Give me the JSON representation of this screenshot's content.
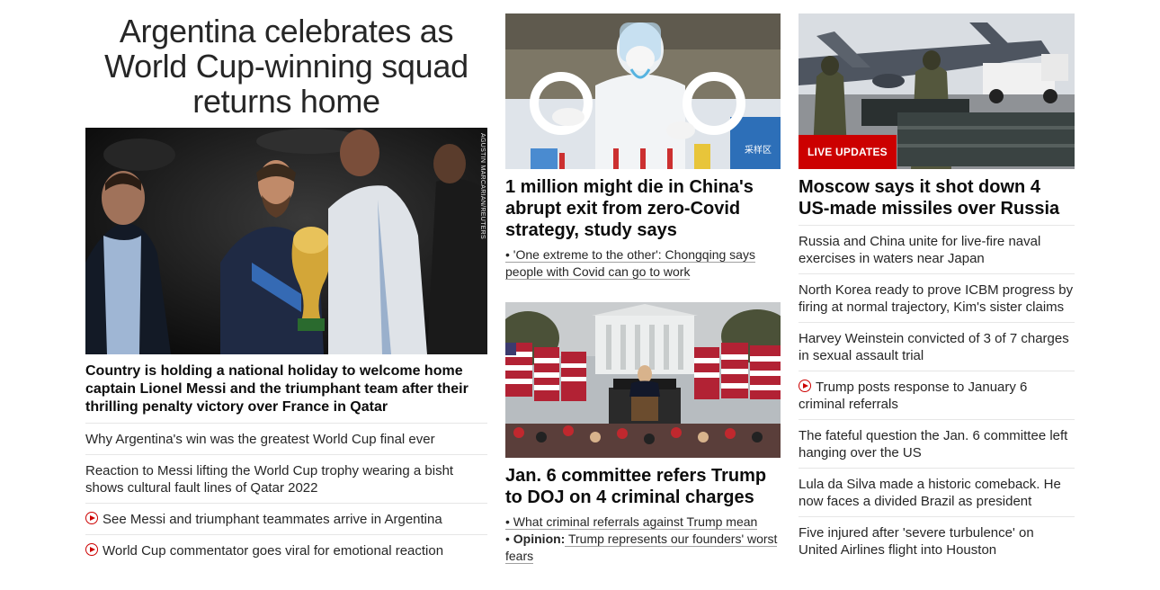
{
  "left": {
    "headline_lines": [
      "Argentina celebrates as",
      "World Cup-winning squad",
      "returns home"
    ],
    "photo_credit": "AGUSTIN MARCARIAN/REUTERS",
    "lead_text": "Country is holding a national holiday to welcome home captain Lionel Messi and the triumphant team after their thrilling penalty victory over France in Qatar",
    "items": [
      {
        "text": "Why Argentina's win was the greatest World Cup final ever",
        "video": false
      },
      {
        "text": "Reaction to Messi lifting the World Cup trophy wearing a bisht shows cultural fault lines of Qatar 2022",
        "video": false
      },
      {
        "text": "See Messi and triumphant teammates arrive in Argentina",
        "video": true
      },
      {
        "text": "World Cup commentator goes viral for emotional reaction",
        "video": true
      }
    ]
  },
  "middle": {
    "story1": {
      "headline": "1 million might die in China's abrupt exit from zero-Covid strategy, study says",
      "image_sign_text": "采样区",
      "links": [
        "• 'One extreme to the other': Chongqing says people with Covid can go to work"
      ]
    },
    "story2": {
      "headline": "Jan. 6 committee refers Trump to DOJ on 4 criminal charges",
      "link1": "• What criminal referrals against Trump mean",
      "link2_prefix": "• ",
      "link2_label": "Opinion:",
      "link2_text": " Trump represents our founders' worst fears"
    }
  },
  "right": {
    "badge": "LIVE UPDATES",
    "headline": "Moscow says it shot down 4 US-made missiles over Russia",
    "items": [
      {
        "text": "Russia and China unite for live-fire naval exercises in waters near Japan",
        "video": false
      },
      {
        "text": "North Korea ready to prove ICBM progress by firing at normal trajectory, Kim's sister claims",
        "video": false
      },
      {
        "text": "Harvey Weinstein convicted of 3 of 7 charges in sexual assault trial",
        "video": false
      },
      {
        "text": "Trump posts response to January 6 criminal referrals",
        "video": true
      },
      {
        "text": "The fateful question the Jan. 6 committee left hanging over the US",
        "video": false
      },
      {
        "text": "Lula da Silva made a historic comeback. He now faces a divided Brazil as president",
        "video": false
      },
      {
        "text": "Five injured after 'severe turbulence' on United Airlines flight into Houston",
        "video": false
      }
    ]
  },
  "colors": {
    "accent_red": "#cc0000",
    "text": "#0c0c0c",
    "divider": "#e6e6e6"
  }
}
